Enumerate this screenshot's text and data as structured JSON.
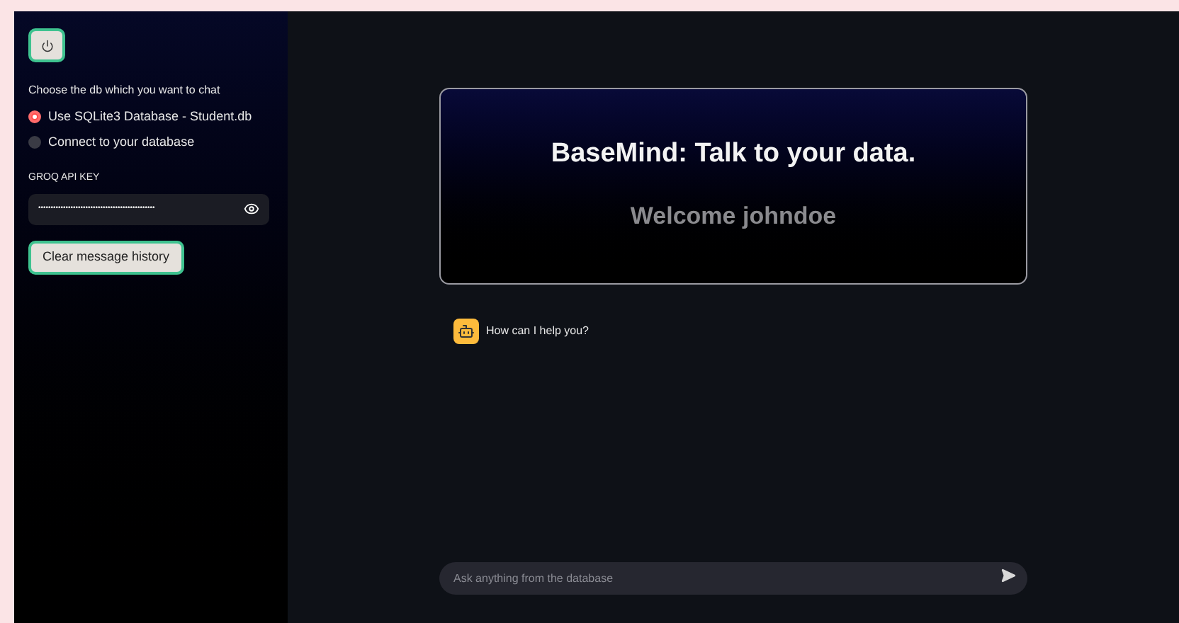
{
  "sidebar": {
    "radio_group": {
      "label": "Choose the db which you want to chat",
      "options": [
        {
          "label": "Use SQLite3 Database - Student.db",
          "selected": true
        },
        {
          "label": "Connect to your database",
          "selected": false
        }
      ]
    },
    "api_key": {
      "label": "GROQ API KEY",
      "value": "•••••••••••••••••••••••••••••••••••••••••••••••"
    },
    "clear_button": "Clear message history"
  },
  "header_card": {
    "title": "BaseMind: Talk to your data.",
    "subtitle": "Welcome johndoe"
  },
  "messages": [
    {
      "kind": "bot",
      "text": "How can I help you?"
    }
  ],
  "chat_input": {
    "placeholder": "Ask anything from the database"
  }
}
